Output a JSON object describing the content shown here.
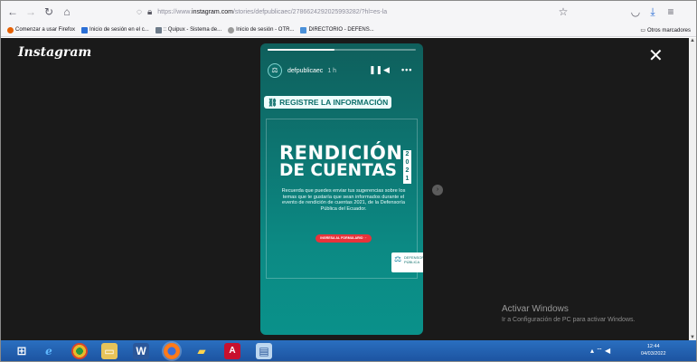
{
  "browser": {
    "url_prefix": "https://www.",
    "url_host": "instagram.com",
    "url_path": "/stories/defpublicaec/2786624292025993282/?hl=es-la",
    "bookmarks": [
      {
        "label": "Comenzar a usar Firefox",
        "color": "#e66000"
      },
      {
        "label": "Inicio de sesión en el c...",
        "color": "#2b6fd6"
      },
      {
        "label": ":: Quipux - Sistema de...",
        "color": "#6d7b8a"
      },
      {
        "label": "Inicio de sesión - OTR...",
        "color": "#9a9a9a"
      },
      {
        "label": "DIRECTORIO - DEFENS...",
        "color": "#4a90d9"
      }
    ],
    "other_bookmarks": "Otros marcadores"
  },
  "instagram": {
    "logo": "Instagram",
    "story": {
      "username": "defpublicaec",
      "time": "1 h",
      "progress_fraction": 0.45,
      "link_sticker": "REGISTRE LA INFORMACIÓN",
      "title_line1": "RENDICIÓN",
      "title_line2": "DE CUENTAS",
      "year_digits": [
        "2",
        "0",
        "2",
        "1"
      ],
      "body": "Recuerda que puedes enviar tus sugerencias sobre los temas que te gustaría que sean informados durante el evento de rendición de cuentas 2021, de la Defensoría Pública del Ecuador.",
      "cta": "INGRESA AL FORMULARIO",
      "logo_text": "DEFENSORÍA PÚBLICA"
    }
  },
  "watermark": {
    "line1": "Activar Windows",
    "line2": "Ir a Configuración de PC para activar Windows."
  },
  "taskbar": {
    "time": "12:44",
    "date": "04/03/2022"
  },
  "colors": {
    "story_teal": "#0d7470",
    "taskbar_blue": "#1f5fae",
    "cta_red": "#e8333a"
  }
}
